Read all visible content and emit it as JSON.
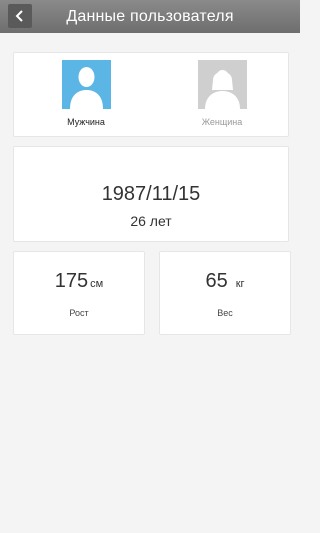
{
  "header": {
    "title": "Данные пользователя"
  },
  "gender": {
    "male_label": "Мужчина",
    "female_label": "Женщина",
    "selected": "male"
  },
  "birth": {
    "date": "1987/11/15",
    "age": "26 лет"
  },
  "height": {
    "value": "175",
    "unit": "см",
    "label": "Рост"
  },
  "weight": {
    "value": "65",
    "unit": "кг",
    "label": "Вес"
  },
  "colors": {
    "navbar": "#7d7d7d",
    "male_avatar": "#5bb6e6",
    "female_avatar": "#cfcfcf"
  }
}
